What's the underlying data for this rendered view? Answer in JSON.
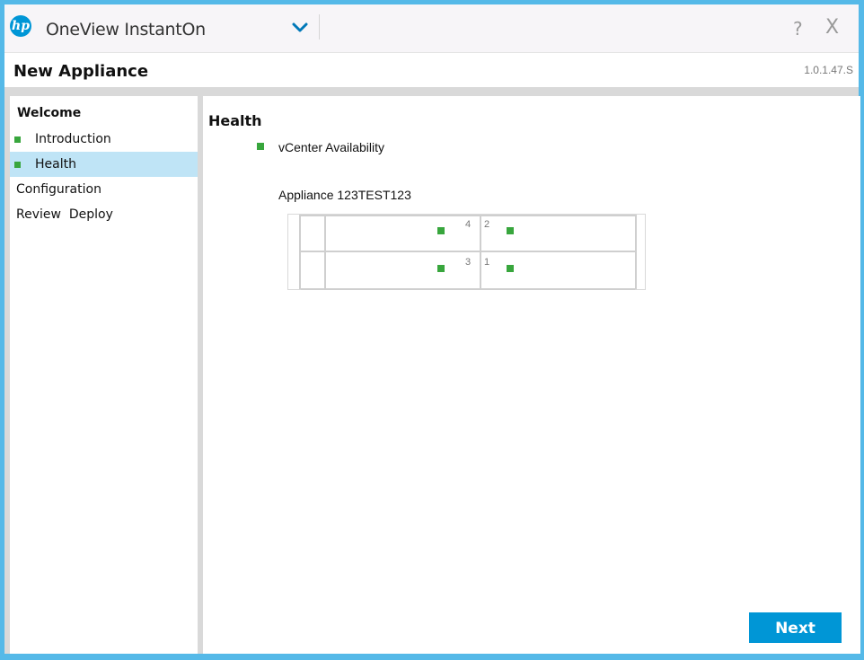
{
  "titlebar": {
    "app_title": "OneView InstantOn",
    "logo_text": "hp",
    "help_label": "?",
    "close_label": "X"
  },
  "header": {
    "title": "New Appliance",
    "version": "1.0.1.47.S"
  },
  "sidebar": {
    "items": [
      {
        "label": "Welcome",
        "bullet": false,
        "selected": false
      },
      {
        "label": "Introduction",
        "bullet": true,
        "selected": false
      },
      {
        "label": "Health",
        "bullet": true,
        "selected": true
      },
      {
        "label": "Configuration",
        "bullet": false,
        "selected": false
      },
      {
        "label": "Review  Deploy",
        "bullet": false,
        "selected": false
      }
    ]
  },
  "main": {
    "title": "Health",
    "vcenter_label": "vCenter Availability",
    "appliance_label": "Appliance 123TEST123",
    "bays": [
      {
        "number": "4",
        "status": "ok"
      },
      {
        "number": "2",
        "status": "ok"
      },
      {
        "number": "3",
        "status": "ok"
      },
      {
        "number": "1",
        "status": "ok"
      }
    ],
    "next_label": "Next"
  },
  "colors": {
    "accent": "#0096d6",
    "status_ok": "#38a63d",
    "selected_bg": "#bfe4f6",
    "frame": "#55b9e8"
  }
}
